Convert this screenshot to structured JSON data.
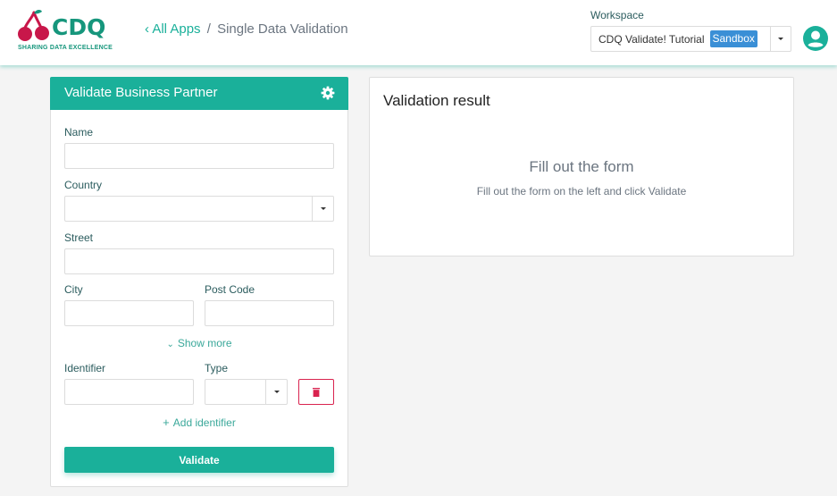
{
  "header": {
    "logo": {
      "word": "CDQ",
      "tagline": "SHARING DATA EXCELLENCE",
      "icon": "cherry-logo-icon"
    },
    "breadcrumb": {
      "back_icon": "chevron-left-icon",
      "back_label": "All Apps",
      "separator": "/",
      "current": "Single Data Validation"
    },
    "workspace": {
      "label": "Workspace",
      "selected": "CDQ Validate! Tutorial",
      "badge": "Sandbox"
    },
    "user_icon": "user-avatar-icon"
  },
  "form": {
    "title": "Validate Business Partner",
    "settings_icon": "gear-icon",
    "fields": {
      "name": {
        "label": "Name",
        "value": "",
        "placeholder": ""
      },
      "country": {
        "label": "Country",
        "value": ""
      },
      "street": {
        "label": "Street",
        "value": "",
        "placeholder": ""
      },
      "city": {
        "label": "City",
        "value": "",
        "placeholder": ""
      },
      "post_code": {
        "label": "Post Code",
        "value": "",
        "placeholder": ""
      },
      "identifier": {
        "label": "Identifier",
        "value": "",
        "placeholder": ""
      },
      "type": {
        "label": "Type",
        "value": ""
      }
    },
    "show_more_label": "Show more",
    "add_identifier_label": "Add identifier",
    "delete_icon": "trash-icon",
    "validate_label": "Validate"
  },
  "result": {
    "title": "Validation result",
    "empty_title": "Fill out the form",
    "empty_subtitle": "Fill out the form on the left and click Validate"
  },
  "colors": {
    "brand_teal": "#1ab09a",
    "logo_green": "#16967c",
    "logo_red": "#c8174a",
    "badge_blue": "#3a8fd6",
    "danger": "#d9234f",
    "background": "#f4f4f4"
  }
}
